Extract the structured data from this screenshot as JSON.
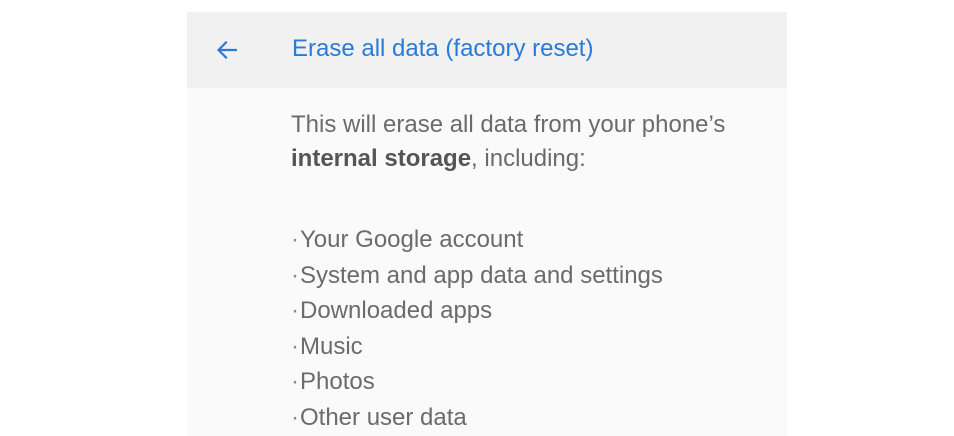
{
  "header": {
    "title": "Erase all data (factory reset)",
    "back_icon": "arrow-left-icon",
    "accent_color": "#2a7ad9"
  },
  "body": {
    "intro_part1": "This will erase all data from your phone’s ",
    "intro_bold": "internal storage",
    "intro_part2": ", including:",
    "bullet": "·",
    "items": [
      "Your Google account",
      "System and app data and settings",
      "Downloaded apps",
      "Music",
      "Photos",
      "Other user data"
    ]
  }
}
